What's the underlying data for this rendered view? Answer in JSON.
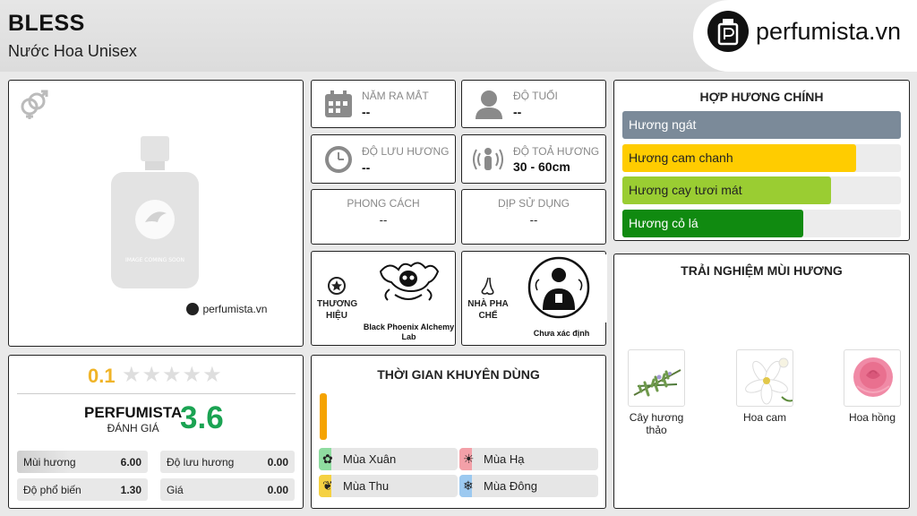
{
  "header": {
    "title": "BLESS",
    "subtitle": "Nước Hoa Unisex",
    "brand_logo_text": "perfumista.vn"
  },
  "image_panel": {
    "placeholder_text": "IMAGE COMING SOON",
    "watermark": "perfumista.vn",
    "gender_icon": "unisex-icon"
  },
  "stats": {
    "launch": {
      "label": "NĂM RA MẮT",
      "value": "--",
      "icon": "calendar-icon"
    },
    "age": {
      "label": "ĐỘ TUỔI",
      "value": "--",
      "icon": "user-icon"
    },
    "longevity": {
      "label": "ĐỘ LƯU HƯƠNG",
      "value": "--",
      "icon": "clock-icon"
    },
    "sillage": {
      "label": "ĐỘ TOẢ HƯƠNG",
      "value": "30 - 60cm",
      "icon": "sillage-icon"
    },
    "style": {
      "label": "PHONG CÁCH",
      "value": "--"
    },
    "occasion": {
      "label": "DỊP SỬ DỤNG",
      "value": "--"
    }
  },
  "brand": {
    "label_line1": "THƯƠNG",
    "label_line2": "HIỆU",
    "name": "Black Phoenix Alchemy Lab",
    "icon": "star-icon"
  },
  "perfumer": {
    "label_line1": "NHÀ PHA",
    "label_line2": "CHẾ",
    "name": "Chưa xác định",
    "icon": "nose-icon"
  },
  "accords": {
    "title": "HỢP HƯƠNG CHÍNH",
    "items": [
      {
        "label": "Hương ngát",
        "level": 1.0,
        "color": "#7b8a99"
      },
      {
        "label": "Hương cam chanh",
        "level": 0.84,
        "color": "#ffcc00"
      },
      {
        "label": "Hương cay tươi mát",
        "level": 0.75,
        "color": "#9acd32"
      },
      {
        "label": "Hương cỏ lá",
        "level": 0.65,
        "color": "#108a10"
      }
    ]
  },
  "experience": {
    "title": "TRẢI NGHIỆM MÙI HƯƠNG",
    "notes": [
      {
        "label": "Cây hương thảo",
        "icon": "rosemary-image"
      },
      {
        "label": "Hoa cam",
        "icon": "orange-blossom-image"
      },
      {
        "label": "Hoa hồng",
        "icon": "rose-image"
      }
    ]
  },
  "ratings": {
    "user_score": "0.1",
    "stars_filled": 0,
    "stars_total": 5,
    "perfumista_label": "PERFUMISTA",
    "perfumista_sub": "ĐÁNH GIÁ",
    "perfumista_score": "3.6",
    "rows": [
      {
        "label": "Mùi hương",
        "value": "6.00"
      },
      {
        "label": "Độ lưu hương",
        "value": "0.00"
      },
      {
        "label": "Độ phổ biến",
        "value": "1.30"
      },
      {
        "label": "Giá",
        "value": "0.00"
      }
    ]
  },
  "time": {
    "title": "THỜI GIAN KHUYÊN DÙNG",
    "seasons": [
      {
        "label": "Mùa Xuân",
        "color": "#8fdca0",
        "icon": "spring-icon"
      },
      {
        "label": "Mùa Hạ",
        "color": "#f3a0a8",
        "icon": "sun-icon"
      },
      {
        "label": "Mùa Thu",
        "color": "#f5d142",
        "icon": "leaf-icon"
      },
      {
        "label": "Mùa Đông",
        "color": "#9cc9f0",
        "icon": "snowflake-icon"
      }
    ],
    "indicator_color": "#f5a300"
  }
}
